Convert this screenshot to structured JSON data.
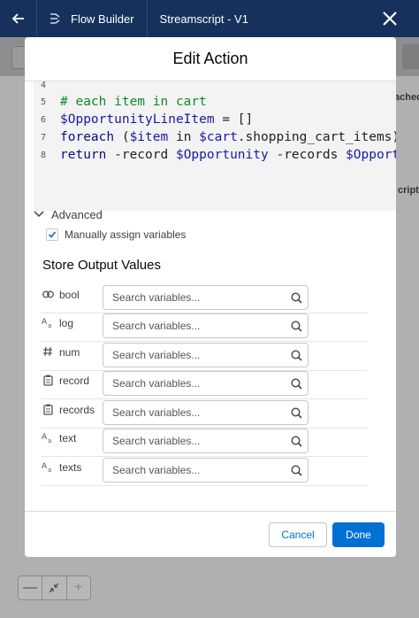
{
  "topbar": {
    "builder_label": "Flow Builder",
    "flow_title": "Streamscript - V1"
  },
  "background": {
    "side_text_1": "ached",
    "side_text_2": "cript"
  },
  "modal": {
    "title": "Edit Action",
    "code_lines": [
      {
        "num": "4",
        "tokens": []
      },
      {
        "num": "5",
        "tokens": [
          {
            "t": "# each item in cart",
            "c": "c-comment"
          }
        ]
      },
      {
        "num": "6",
        "tokens": [
          {
            "t": "$OpportunityLineItem",
            "c": "c-var"
          },
          {
            "t": " = []",
            "c": "c-plain"
          }
        ]
      },
      {
        "num": "7",
        "tokens": [
          {
            "t": "foreach",
            "c": "c-kw"
          },
          {
            "t": " (",
            "c": "c-plain"
          },
          {
            "t": "$item",
            "c": "c-var"
          },
          {
            "t": " in ",
            "c": "c-plain"
          },
          {
            "t": "$cart",
            "c": "c-var"
          },
          {
            "t": ".shopping_cart_items)",
            "c": "c-prop"
          }
        ]
      },
      {
        "num": "8",
        "tokens": [
          {
            "t": "return",
            "c": "c-kw"
          },
          {
            "t": " -record ",
            "c": "c-plain"
          },
          {
            "t": "$Opportunity",
            "c": "c-var"
          },
          {
            "t": " -records ",
            "c": "c-plain"
          },
          {
            "t": "$Opport",
            "c": "c-var"
          }
        ]
      }
    ],
    "advanced_label": "Advanced",
    "manual_assign_label": "Manually assign variables",
    "manual_assign_checked": true,
    "store_output_title": "Store Output Values",
    "outputs": [
      {
        "label": "bool",
        "icon": "boolean-icon",
        "placeholder": "Search variables..."
      },
      {
        "label": "log",
        "icon": "text-icon",
        "placeholder": "Search variables..."
      },
      {
        "label": "num",
        "icon": "number-icon",
        "placeholder": "Search variables..."
      },
      {
        "label": "record",
        "icon": "record-icon",
        "placeholder": "Search variables..."
      },
      {
        "label": "records",
        "icon": "record-icon",
        "placeholder": "Search variables..."
      },
      {
        "label": "text",
        "icon": "text-icon",
        "placeholder": "Search variables..."
      },
      {
        "label": "texts",
        "icon": "text-icon",
        "placeholder": "Search variables..."
      }
    ],
    "cancel_label": "Cancel",
    "done_label": "Done"
  },
  "colors": {
    "topbar": "#16325c",
    "brand": "#0070d2",
    "comment": "#108a2a",
    "variable": "#1a1aa6"
  }
}
